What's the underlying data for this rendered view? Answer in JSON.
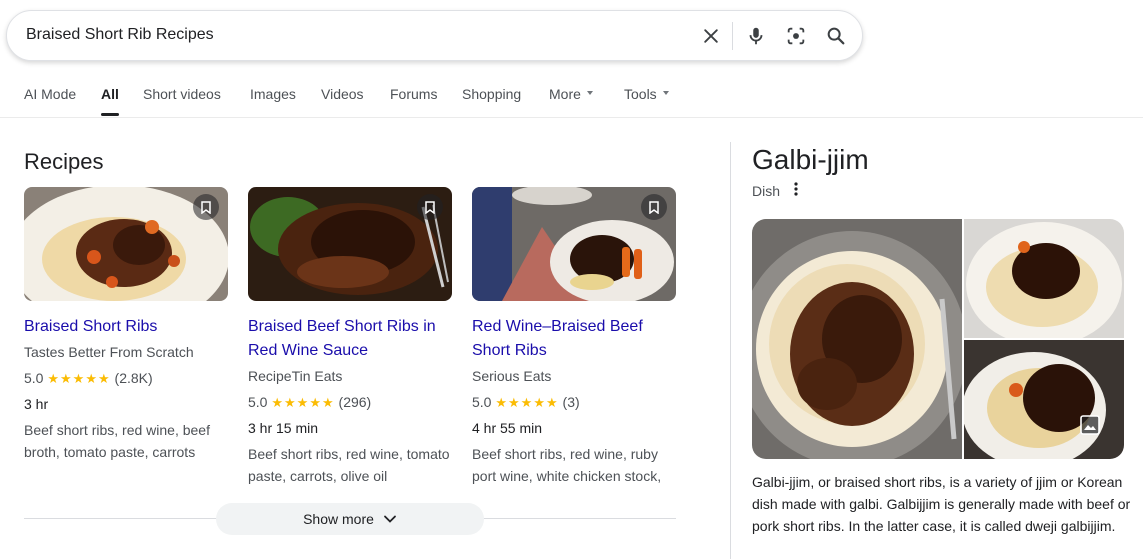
{
  "search": {
    "query": "Braised Short Rib Recipes",
    "icons": [
      "close-icon",
      "microphone-icon",
      "lens-icon",
      "search-icon"
    ]
  },
  "tabs": [
    {
      "label": "AI Mode",
      "active": false
    },
    {
      "label": "All",
      "active": true
    },
    {
      "label": "Short videos",
      "active": false
    },
    {
      "label": "Images",
      "active": false
    },
    {
      "label": "Videos",
      "active": false
    },
    {
      "label": "Forums",
      "active": false
    },
    {
      "label": "Shopping",
      "active": false
    },
    {
      "label": "More",
      "active": false
    },
    {
      "label": "Tools",
      "active": false
    }
  ],
  "recipes": {
    "title": "Recipes",
    "cards": [
      {
        "title": "Braised Short Ribs",
        "source": "Tastes Better From Scratch",
        "rating": "5.0",
        "stars": "★★★★★",
        "reviews": "(2.8K)",
        "time": "3 hr",
        "ingredients": "Beef short ribs, red wine, beef broth, tomato paste, carrots"
      },
      {
        "title": "Braised Beef Short Ribs in Red Wine Sauce",
        "source": "RecipeTin Eats",
        "rating": "5.0",
        "stars": "★★★★★",
        "reviews": "(296)",
        "time": "3 hr 15 min",
        "ingredients": "Beef short ribs, red wine, tomato paste, carrots, olive oil"
      },
      {
        "title": "Red Wine–Braised Beef Short Ribs",
        "source": "Serious Eats",
        "rating": "5.0",
        "stars": "★★★★★",
        "reviews": "(3)",
        "time": "4 hr 55 min",
        "ingredients": "Beef short ribs, red wine, ruby port wine, white chicken stock,"
      }
    ],
    "show_more": "Show more"
  },
  "knowledge_panel": {
    "title": "Galbi-jjim",
    "subtitle": "Dish",
    "description": "Galbi-jjim, or braised short ribs, is a variety of jjim or Korean dish made with galbi. Galbijjim is generally made with beef or pork short ribs. In the latter case, it is called dweji galbijjim."
  },
  "colors": {
    "link": "#1a0dab",
    "star": "#fbbc04",
    "muted_text": "#4d5156"
  }
}
